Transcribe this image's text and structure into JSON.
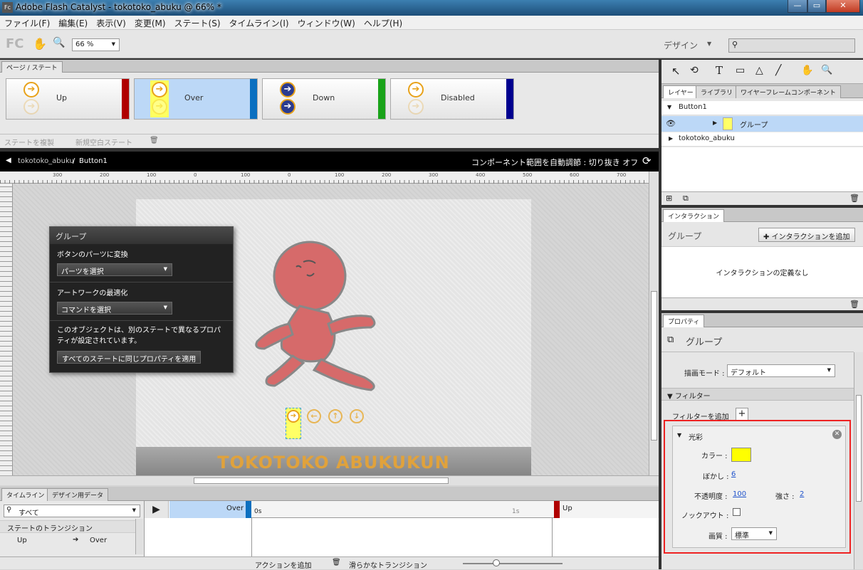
{
  "window": {
    "title": "Adobe Flash Catalyst - tokotoko_abuku @ 66% *",
    "app_icon": "Fc",
    "minimize": "—",
    "maximize": "▭",
    "close": "✕"
  },
  "menu": [
    "ファイル(F)",
    "編集(E)",
    "表示(V)",
    "変更(M)",
    "ステート(S)",
    "タイムライン(I)",
    "ウィンドウ(W)",
    "ヘルプ(H)"
  ],
  "toolbar": {
    "logo": "FC",
    "zoom": "66 %",
    "workspace": "デザイン",
    "search_placeholder": ""
  },
  "pages": {
    "tab": "ページ / ステート",
    "states": [
      {
        "name": "Up",
        "color": "#b00000"
      },
      {
        "name": "Over",
        "color": "#0a6fc0"
      },
      {
        "name": "Down",
        "color": "#1aa31a"
      },
      {
        "name": "Disabled",
        "color": "#00008f"
      }
    ],
    "duplicate": "ステートを複製",
    "new_blank": "新規空白ステート"
  },
  "breadcrumb": {
    "root": "tokotoko_abuku",
    "sep": "/",
    "current": "Button1",
    "right": "コンポーネント範囲を自動調節 : 切り抜き オフ"
  },
  "ruler": [
    "300",
    "200",
    "100",
    "0",
    "100",
    "200",
    "300",
    "400",
    "500",
    "0",
    "100",
    "200",
    "300",
    "400",
    "500",
    "600",
    "700"
  ],
  "artboard": {
    "banner": "TOKOTOKO ABUKUKUN"
  },
  "hud": {
    "title": "グループ",
    "convert_label": "ボタンのパーツに変換",
    "convert_select": "パーツを選択",
    "optimize_label": "アートワークの最適化",
    "optimize_select": "コマンドを選択",
    "note": "このオブジェクトは、別のステートで異なるプロパティが設定されています。",
    "apply_all": "すべてのステートに同じプロパティを適用"
  },
  "timeline": {
    "tabs": [
      "タイムライン",
      "デザイン用データ"
    ],
    "filter": "すべて",
    "section": "ステートのトランジション",
    "rows": [
      {
        "from": "Up",
        "arrow": "➔",
        "to": "Over"
      }
    ],
    "track_from": "Over",
    "track_to": "Up",
    "t0": "0s",
    "t1": "1s",
    "add_action": "アクションを追加",
    "smooth": "滑らかなトランジション"
  },
  "layers": {
    "tabs": [
      "レイヤー",
      "ライブラリ",
      "ワイヤーフレームコンポーネント"
    ],
    "items": [
      "Button1",
      "グループ",
      "tokotoko_abuku"
    ]
  },
  "interactions": {
    "tab": "インタラクション",
    "title": "グループ",
    "add": "インタラクションを追加",
    "empty": "インタラクションの定義なし"
  },
  "properties": {
    "tab": "プロパティ",
    "title": "グループ",
    "blend_label": "描画モード :",
    "blend_value": "デフォルト",
    "filters_header": "フィルター",
    "add_filter": "フィルターを追加",
    "glow": {
      "title": "光彩",
      "color_label": "カラー :",
      "color": "#ffff00",
      "blur_label": "ぼかし :",
      "blur": "6",
      "opacity_label": "不透明度 :",
      "opacity": "100",
      "strength_label": "強さ :",
      "strength": "2",
      "knockout_label": "ノックアウト :",
      "quality_label": "画質 :",
      "quality": "標準"
    }
  }
}
